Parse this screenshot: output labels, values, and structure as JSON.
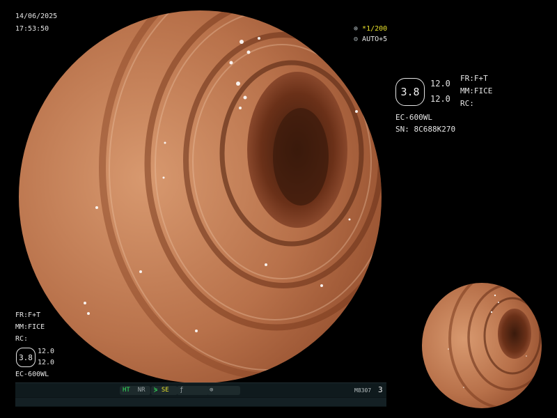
{
  "overlay": {
    "date": "14/06/2025",
    "time": "17:53:50",
    "zoom": "*1/200",
    "auto": "AUTO+5"
  },
  "right_panel": {
    "hex_value": "3.8",
    "value_top": "12.0",
    "value_bottom": "12.0",
    "fr": "FR:F+T",
    "mm": "MM:FICE",
    "rc": "RC:",
    "model": "EC-600WL",
    "serial": "SN: 8C688K270"
  },
  "left_panel": {
    "fr": "FR:F+T",
    "mm": "MM:FICE",
    "rc": "RC:",
    "hex_value": "3.8",
    "value_top": "12.0",
    "value_bottom": "12.0",
    "model": "EC-600WL"
  },
  "status_bar": {
    "ht": "HT",
    "nr": "NR",
    "se": "SE",
    "code": "M8307",
    "count": "3"
  },
  "colors": {
    "tissue_base": "#b8714a",
    "tissue_dark": "#6a3018",
    "tissue_light": "#e0a884",
    "green_indicator": "#32e05a",
    "yellow_indicator": "#e8e02a"
  }
}
